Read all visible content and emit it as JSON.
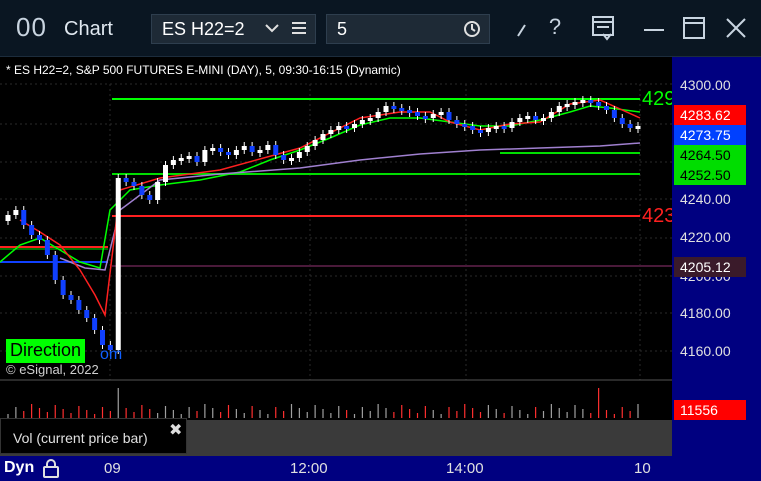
{
  "titlebar": {
    "app_icon_text": "00",
    "title": "Chart",
    "symbol": "ES H22=2",
    "interval": "5"
  },
  "chart": {
    "header": "* ES H22=2, S&P 500 FUTURES E-MINI (DAY), 5, 09:30-16:15 (Dynamic)",
    "price_ticks": [
      "4300.00",
      "4240.00",
      "4220.00",
      "4200.00",
      "4180.00",
      "4160.00"
    ],
    "price_tags": [
      "4283.62",
      "4273.75",
      "4264.50",
      "4252.50",
      "4205.12"
    ],
    "line_label_green": "429",
    "line_label_red": "423",
    "direction_label": "Direction",
    "direction_tail": "om",
    "copyright": "© eSignal, 2022",
    "volume_tag": "11556",
    "volume_tooltip": "Vol (current price bar)",
    "tooltip_close": "✖",
    "colors": {
      "up": "#00ff00",
      "down": "#1040ff",
      "resistance": "#00ff00",
      "support": "#ff0000",
      "axis_bg": "#000080"
    }
  },
  "time_axis": {
    "dyn_label": "Dyn",
    "ticks": [
      "09",
      "12:00",
      "14:00",
      "10"
    ]
  }
}
